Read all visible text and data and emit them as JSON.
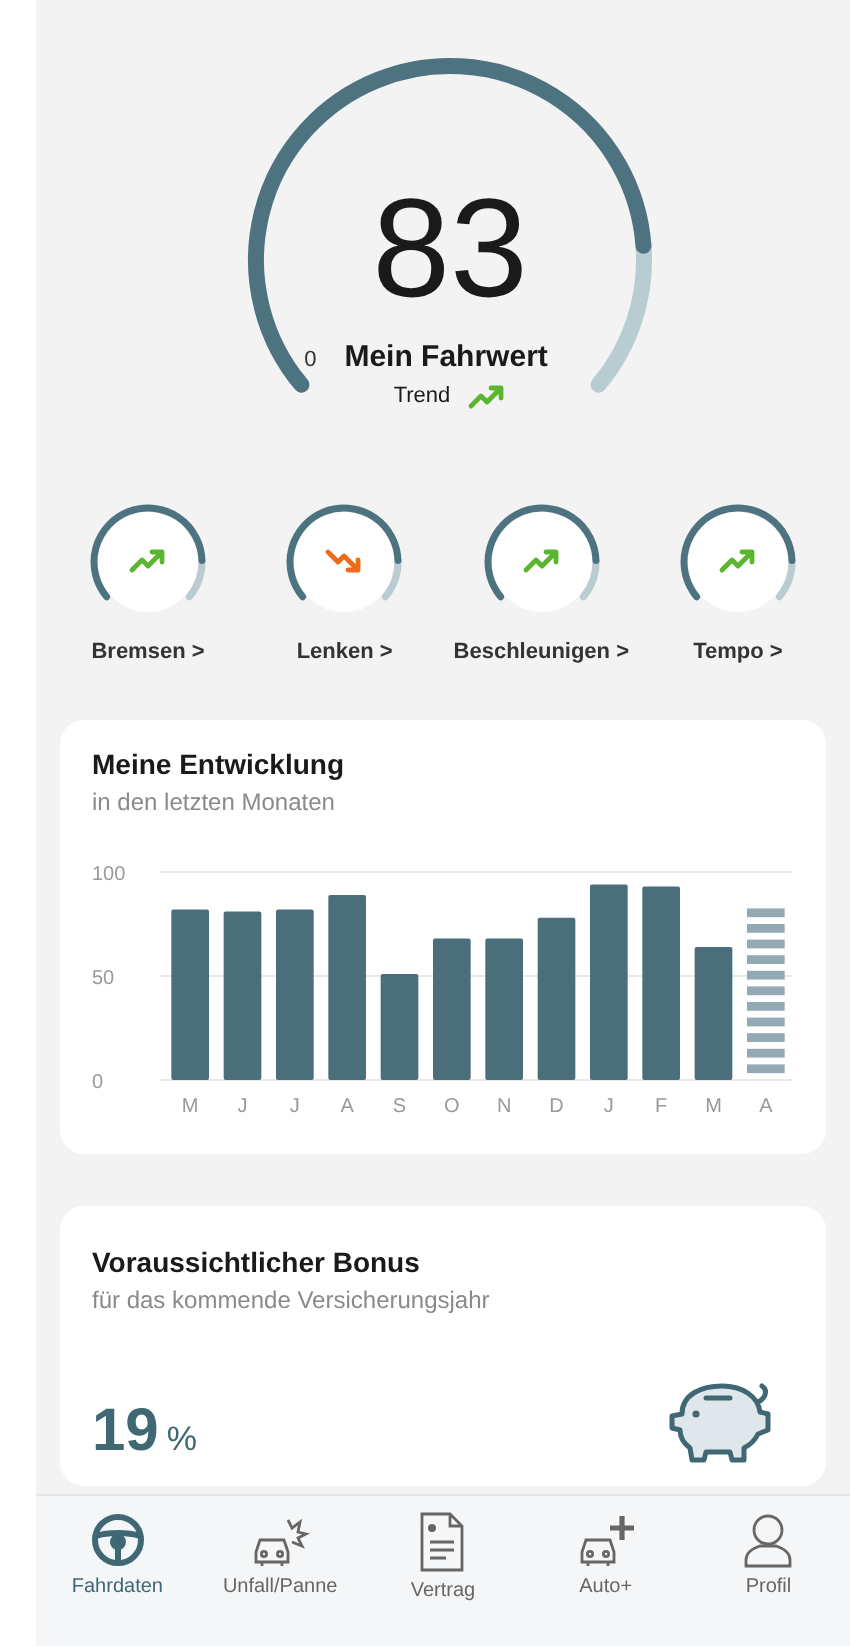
{
  "score": {
    "value": "83",
    "min_label": "0",
    "title": "Mein Fahrwert",
    "trend_label": "Trend",
    "kind": "up"
  },
  "categories": [
    {
      "label": "Bremsen >",
      "kind": "up"
    },
    {
      "label": "Lenken >",
      "kind": "down"
    },
    {
      "label": "Beschleunigen >",
      "kind": "up"
    },
    {
      "label": "Tempo >",
      "kind": "up"
    }
  ],
  "development": {
    "title": "Meine Entwicklung",
    "subtitle": "in den letzten Monaten",
    "chart_data": {
      "type": "bar",
      "categories": [
        "M",
        "J",
        "J",
        "A",
        "S",
        "O",
        "N",
        "D",
        "J",
        "F",
        "M",
        "A"
      ],
      "ylim": [
        0,
        100
      ],
      "yticks": [
        0,
        50,
        100
      ],
      "stacked": true,
      "series": [
        {
          "color": "#4b6e7b",
          "values": [
            82,
            81,
            82,
            89,
            51,
            68,
            68,
            78,
            94,
            93,
            64,
            null
          ]
        },
        {
          "color": "#93aab4",
          "values": [
            null,
            null,
            null,
            null,
            null,
            null,
            null,
            null,
            null,
            null,
            null,
            83
          ]
        }
      ]
    }
  },
  "bonus": {
    "title": "Voraussichtlicher Bonus",
    "subtitle": "für das kommende Versicherungsjahr",
    "value": "19",
    "unit": "%"
  },
  "tab_bar": [
    {
      "label": "Fahrdaten",
      "kind": "wheel",
      "selected": true
    },
    {
      "label": "Unfall/Panne",
      "kind": "crash",
      "selected": false
    },
    {
      "label": "Vertrag",
      "kind": "document",
      "selected": false
    },
    {
      "label": "Auto+",
      "kind": "carplus",
      "selected": false
    },
    {
      "label": "Profil",
      "kind": "person",
      "selected": false
    }
  ]
}
